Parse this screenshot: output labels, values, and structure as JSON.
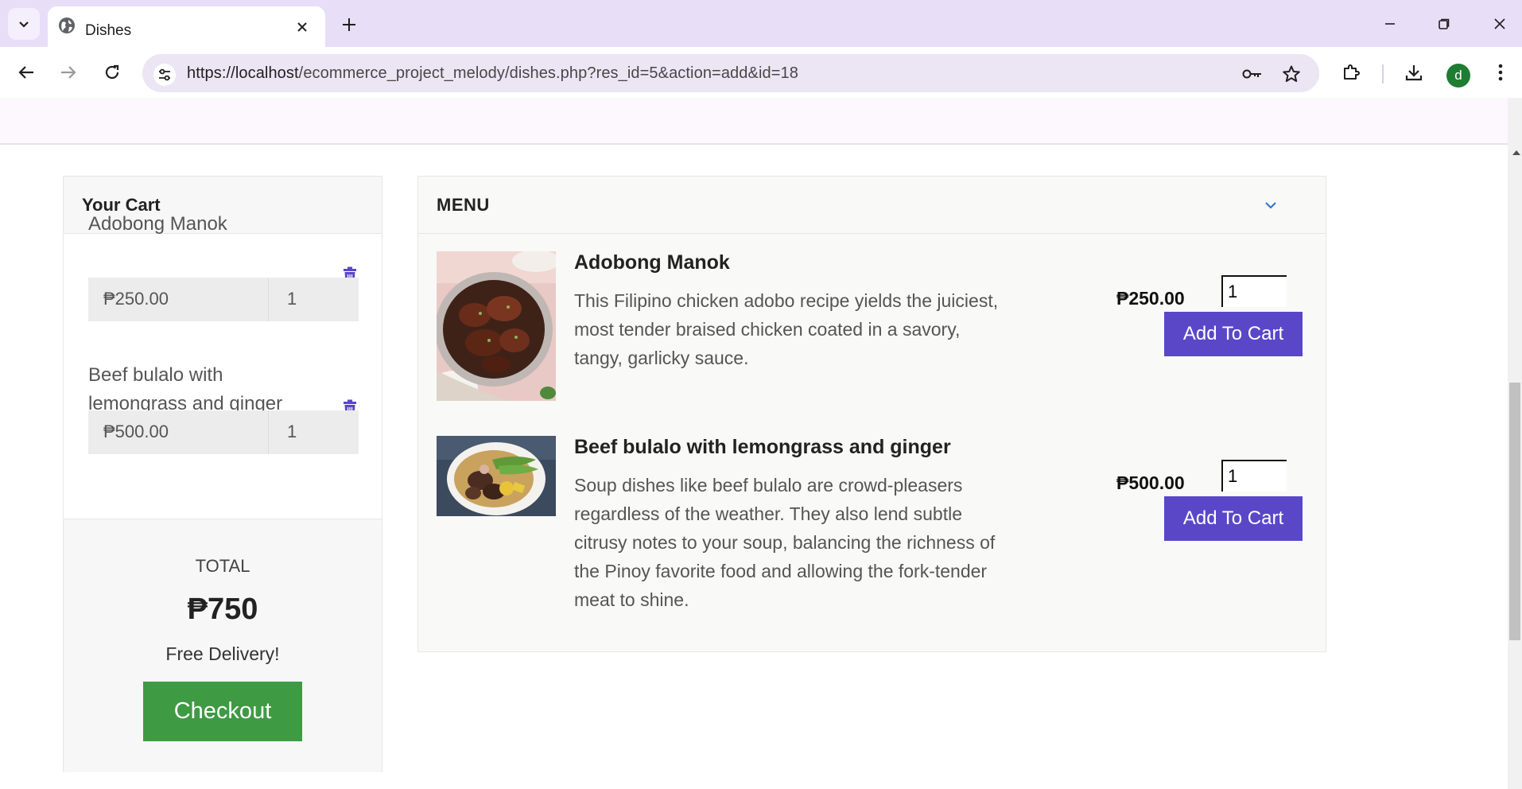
{
  "browser": {
    "tab_title": "Dishes",
    "url_host": "https://localhost",
    "url_rest": "/ecommerce_project_melody/dishes.php?res_id=5&action=add&id=18",
    "profile_initial": "d"
  },
  "cart": {
    "title": "Your Cart",
    "items": [
      {
        "name": "Adobong Manok",
        "price": "₱250.00",
        "qty": "1"
      },
      {
        "name": "Beef bulalo with lemongrass and ginger",
        "price": "₱500.00",
        "qty": "1"
      }
    ],
    "total_label": "TOTAL",
    "total_value": "₱750",
    "delivery_note": "Free Delivery!",
    "checkout_label": "Checkout"
  },
  "menu": {
    "title": "MENU",
    "dishes": [
      {
        "name": "Adobong Manok",
        "description": "This Filipino chicken adobo recipe yields the juiciest, most tender braised chicken coated in a savory, tangy, garlicky sauce.",
        "price": "₱250.00",
        "qty": "1",
        "button_label": "Add To Cart"
      },
      {
        "name": "Beef bulalo with lemongrass and ginger",
        "description": "Soup dishes like beef bulalo are crowd-pleasers regardless of the weather. They also lend subtle citrusy notes to your soup, balancing the richness of the Pinoy favorite food and allowing the fork-tender meat to shine.",
        "price": "₱500.00",
        "qty": "1",
        "button_label": "Add To Cart"
      }
    ]
  },
  "colors": {
    "accent_purple": "#5a47c8",
    "checkout_green": "#3e9b44",
    "tabbar": "#e8def8"
  }
}
